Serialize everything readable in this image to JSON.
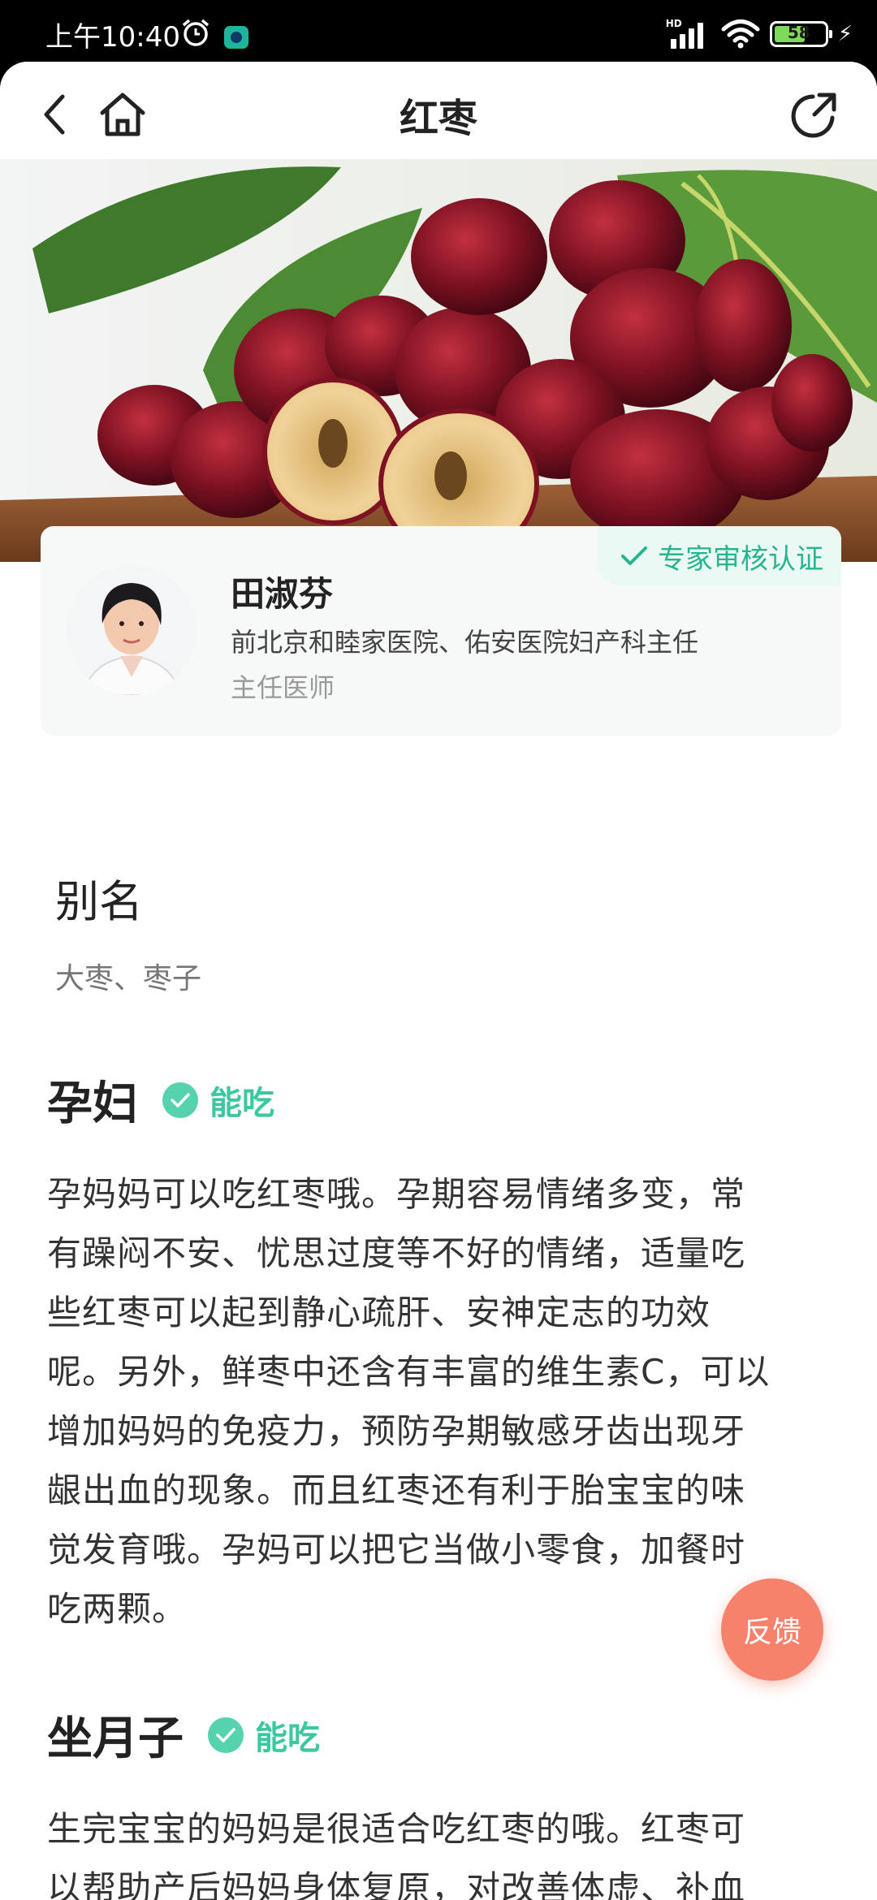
{
  "status_bar": {
    "time": "上午10:40",
    "network_label": "HD",
    "battery": "58"
  },
  "nav": {
    "title": "红枣"
  },
  "expert": {
    "badge": "专家审核认证",
    "name": "田淑芬",
    "org": "前北京和睦家医院、佑安医院妇产科主任",
    "title": "主任医师"
  },
  "alias": {
    "heading": "别名",
    "text": "大枣、枣子"
  },
  "sections": [
    {
      "heading": "孕妇",
      "verdict": "能吃",
      "lines": [
        "孕妈妈可以吃红枣哦。孕期容易情绪多变，常",
        "有躁闷不安、忧思过度等不好的情绪，适量吃",
        "些红枣可以起到静心疏肝、安神定志的功效",
        "呢。另外，鲜枣中还含有丰富的维生素C，可以",
        "增加妈妈的免疫力，预防孕期敏感牙齿出现牙",
        "龈出血的现象。而且红枣还有利于胎宝宝的味",
        "觉发育哦。孕妈可以把它当做小零食，加餐时",
        "吃两颗。"
      ]
    },
    {
      "heading": "坐月子",
      "verdict": "能吃",
      "lines": [
        "生完宝宝的妈妈是很适合吃红枣的哦。红枣可",
        "以帮助产后妈妈身体复原，对改善体虚、补血"
      ]
    }
  ],
  "feedback_label": "反馈",
  "colors": {
    "accent": "#3cc7a0",
    "feedback": "#f7826c",
    "badge_bg": "#eaf9f4"
  }
}
